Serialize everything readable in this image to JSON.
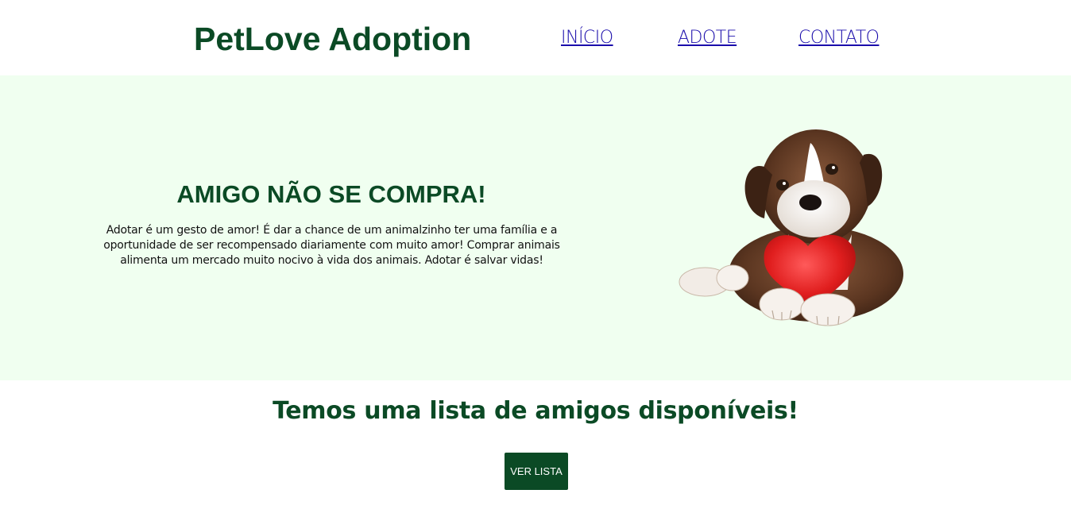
{
  "header": {
    "logo": "PetLove Adoption",
    "nav": [
      {
        "label": "INÍCIO"
      },
      {
        "label": "ADOTE"
      },
      {
        "label": "CONTATO"
      }
    ]
  },
  "hero": {
    "title": "AMIGO NÃO SE COMPRA!",
    "text": "Adotar é um gesto de amor! É dar a chance de um animalzinho ter uma família e a oportunidade de ser recompensado diariamente com muito amor! Comprar animais alimenta um mercado muito nocivo à vida dos animais. Adotar é salvar vidas!",
    "image": "boxer-puppy-with-red-heart"
  },
  "list_section": {
    "title": "Temos uma lista de amigos disponíveis!",
    "button_label": "VER LISTA"
  },
  "colors": {
    "brand_green": "#0b4a25",
    "hero_background": "#f0fff0",
    "link": "#1a0dab"
  }
}
